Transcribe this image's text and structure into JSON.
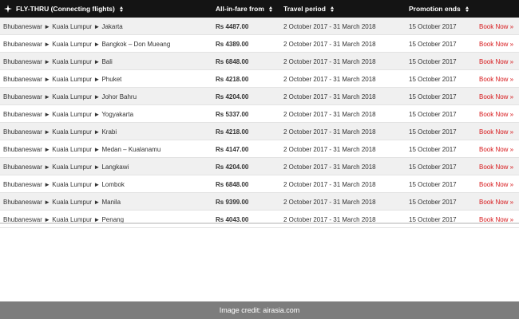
{
  "header": {
    "route_title": "FLY-THRU (Connecting flights)",
    "fare_title": "All-in-fare from",
    "travel_title": "Travel period",
    "promo_title": "Promotion ends"
  },
  "rows": [
    {
      "route": "Bhubaneswar ► Kuala Lumpur ► Jakarta",
      "fare": "Rs 4487.00",
      "travel": "2 October 2017 - 31 March 2018",
      "promo": "15 October 2017",
      "book": "Book Now »"
    },
    {
      "route": "Bhubaneswar ► Kuala Lumpur ► Bangkok – Don Mueang",
      "fare": "Rs 4389.00",
      "travel": "2 October 2017 - 31 March 2018",
      "promo": "15 October 2017",
      "book": "Book Now »"
    },
    {
      "route": "Bhubaneswar ► Kuala Lumpur ► Bali",
      "fare": "Rs 6848.00",
      "travel": "2 October 2017 - 31 March 2018",
      "promo": "15 October 2017",
      "book": "Book Now »"
    },
    {
      "route": "Bhubaneswar ► Kuala Lumpur ► Phuket",
      "fare": "Rs 4218.00",
      "travel": "2 October 2017 - 31 March 2018",
      "promo": "15 October 2017",
      "book": "Book Now »"
    },
    {
      "route": "Bhubaneswar ► Kuala Lumpur ► Johor Bahru",
      "fare": "Rs 4204.00",
      "travel": "2 October 2017 - 31 March 2018",
      "promo": "15 October 2017",
      "book": "Book Now »"
    },
    {
      "route": "Bhubaneswar ► Kuala Lumpur ► Yogyakarta",
      "fare": "Rs 5337.00",
      "travel": "2 October 2017 - 31 March 2018",
      "promo": "15 October 2017",
      "book": "Book Now »"
    },
    {
      "route": "Bhubaneswar ► Kuala Lumpur ► Krabi",
      "fare": "Rs 4218.00",
      "travel": "2 October 2017 - 31 March 2018",
      "promo": "15 October 2017",
      "book": "Book Now »"
    },
    {
      "route": "Bhubaneswar ► Kuala Lumpur ► Medan – Kualanamu",
      "fare": "Rs 4147.00",
      "travel": "2 October 2017 - 31 March 2018",
      "promo": "15 October 2017",
      "book": "Book Now »"
    },
    {
      "route": "Bhubaneswar ► Kuala Lumpur ► Langkawi",
      "fare": "Rs 4204.00",
      "travel": "2 October 2017 - 31 March 2018",
      "promo": "15 October 2017",
      "book": "Book Now »"
    },
    {
      "route": "Bhubaneswar ► Kuala Lumpur ► Lombok",
      "fare": "Rs 6848.00",
      "travel": "2 October 2017 - 31 March 2018",
      "promo": "15 October 2017",
      "book": "Book Now »"
    },
    {
      "route": "Bhubaneswar ► Kuala Lumpur ► Manila",
      "fare": "Rs 9399.00",
      "travel": "2 October 2017 - 31 March 2018",
      "promo": "15 October 2017",
      "book": "Book Now »"
    },
    {
      "route": "Bhubaneswar ► Kuala Lumpur ► Penang",
      "fare": "Rs 4043.00",
      "travel": "2 October 2017 - 31 March 2018",
      "promo": "15 October 2017",
      "book": "Book Now »"
    }
  ],
  "credit": "Image credit: airasia.com",
  "colors": {
    "header_bg": "#141414",
    "row_alt_bg": "#f0f0f0",
    "book_link": "#d7191c",
    "credit_bar": "#7d7d7d"
  },
  "icons": {
    "logo": "plane-emblem-icon",
    "sort": "sort-arrows-icon"
  }
}
